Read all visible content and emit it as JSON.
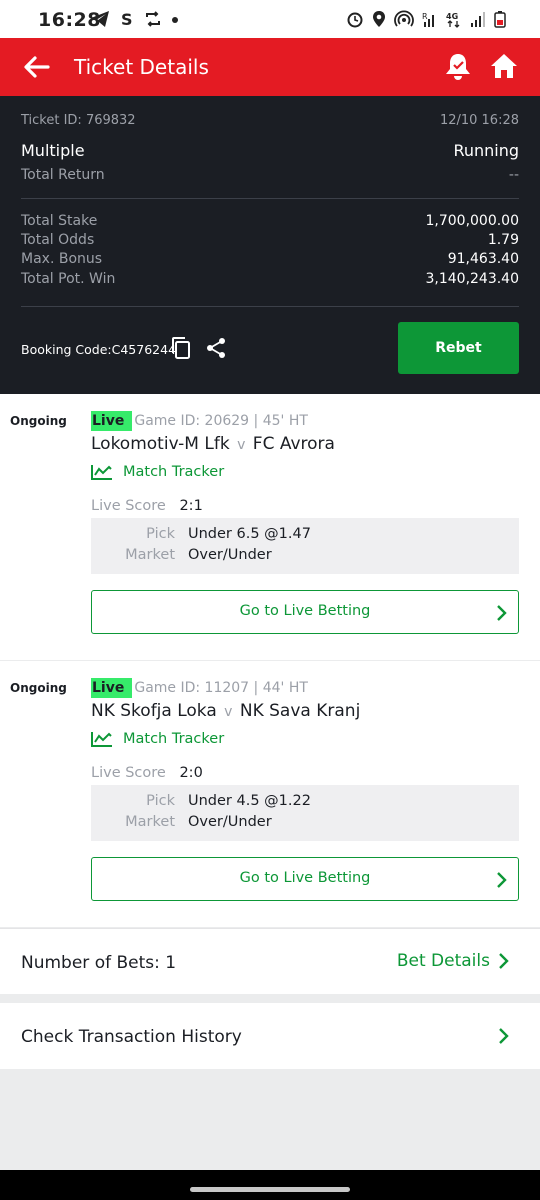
{
  "status_bar": {
    "time": "16:28"
  },
  "app_bar": {
    "title": "Ticket Details"
  },
  "ticket": {
    "id_label": "Ticket ID: 769832",
    "datetime": "12/10 16:28",
    "type": "Multiple",
    "status": "Running",
    "total_return_label": "Total Return",
    "total_return_value": "--",
    "totals": [
      {
        "label": "Total Stake",
        "value": "1,700,000.00"
      },
      {
        "label": "Total Odds",
        "value": "1.79"
      },
      {
        "label": "Max. Bonus",
        "value": "91,463.40"
      },
      {
        "label": "Total Pot. Win",
        "value": "3,140,243.40"
      }
    ],
    "booking_code": "Booking Code:C4576244",
    "rebet_label": "Rebet"
  },
  "bets": [
    {
      "status": "Ongoing",
      "live": "Live",
      "game_meta": "Game ID: 20629 | 45' HT",
      "home": "Lokomotiv-M Lfk",
      "vs": "v",
      "away": "FC Avrora",
      "tracker_label": "Match Tracker",
      "score_label": "Live Score",
      "score": "2:1",
      "pick_label": "Pick",
      "pick": "Under 6.5 @1.47",
      "market_label": "Market",
      "market": "Over/Under",
      "go_live_label": "Go to Live Betting"
    },
    {
      "status": "Ongoing",
      "live": "Live",
      "game_meta": "Game ID: 11207 | 44' HT",
      "home": "NK Skofja Loka",
      "vs": "v",
      "away": "NK Sava Kranj",
      "tracker_label": "Match Tracker",
      "score_label": "Live Score",
      "score": "2:0",
      "pick_label": "Pick",
      "pick": "Under 4.5 @1.22",
      "market_label": "Market",
      "market": "Over/Under",
      "go_live_label": "Go to Live Betting"
    }
  ],
  "footer": {
    "num_bets": "Number of Bets: 1",
    "bet_details": "Bet Details",
    "history": "Check Transaction History"
  },
  "colors": {
    "brand_red": "#e41b23",
    "accent_green": "#0d9737",
    "live_green": "#36eb6a",
    "dark_bg": "#1b1e24"
  },
  "icons": [
    "back-arrow-icon",
    "bell-icon",
    "home-icon",
    "copy-icon",
    "share-icon",
    "chart-line-icon",
    "chevron-right-icon"
  ]
}
